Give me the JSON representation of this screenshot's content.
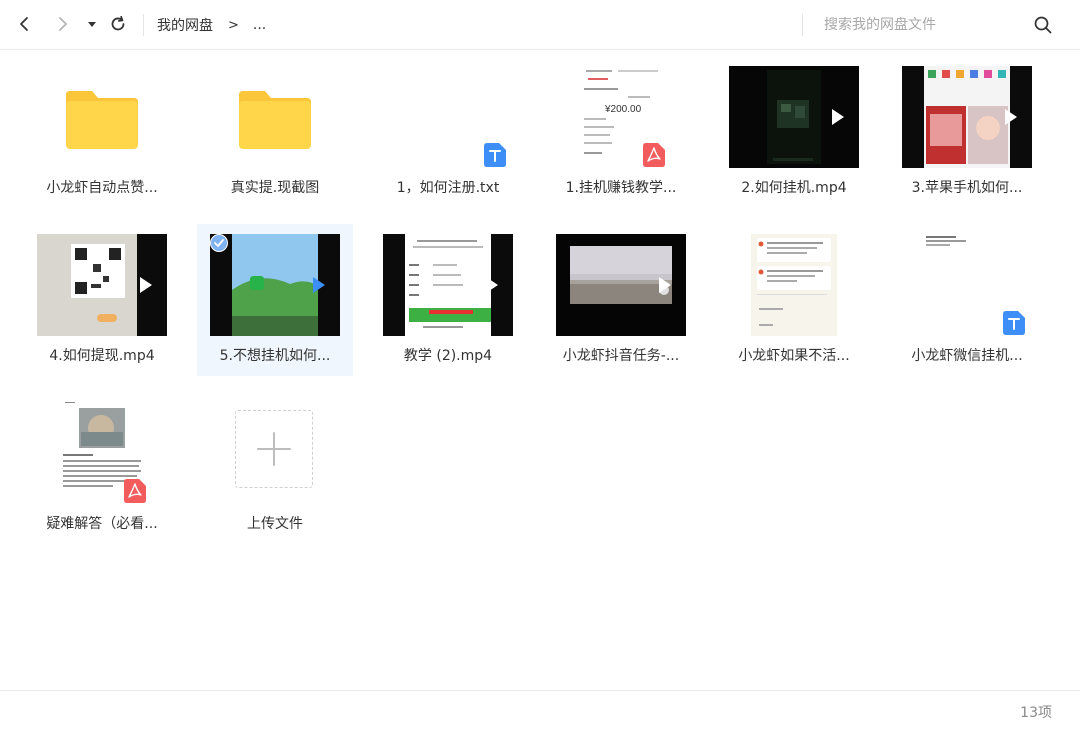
{
  "toolbar": {
    "breadcrumb": [
      "我的网盘",
      "..."
    ],
    "breadcrumb_separator": ">",
    "search_placeholder": "搜索我的网盘文件"
  },
  "items": [
    {
      "name": "小龙虾自动点赞...",
      "kind": "folder"
    },
    {
      "name": "真实提.现截图",
      "kind": "folder"
    },
    {
      "name": "1，如何注册.txt",
      "kind": "txt"
    },
    {
      "name": "1.挂机赚钱教学...",
      "kind": "pdf",
      "preview_amount": "¥200.00"
    },
    {
      "name": "2.如何挂机.mp4",
      "kind": "video"
    },
    {
      "name": "3.苹果手机如何...",
      "kind": "video"
    },
    {
      "name": "4.如何提现.mp4",
      "kind": "video"
    },
    {
      "name": "5.不想挂机如何...",
      "kind": "video",
      "selected": true
    },
    {
      "name": "教学 (2).mp4",
      "kind": "video"
    },
    {
      "name": "小龙虾抖音任务-...",
      "kind": "video"
    },
    {
      "name": "小龙虾如果不活...",
      "kind": "image"
    },
    {
      "name": "小龙虾微信挂机...",
      "kind": "txt"
    },
    {
      "name": "疑难解答（必看...",
      "kind": "pdf"
    },
    {
      "name": "上传文件",
      "kind": "upload"
    }
  ],
  "status": {
    "count_label": "13项"
  },
  "colors": {
    "folder": "#ffd54a",
    "folder_tab": "#fcc63a",
    "accent_blue": "#3d8ef7",
    "pdf_red": "#f25c5c",
    "selected_bg": "#f0f6fd"
  }
}
